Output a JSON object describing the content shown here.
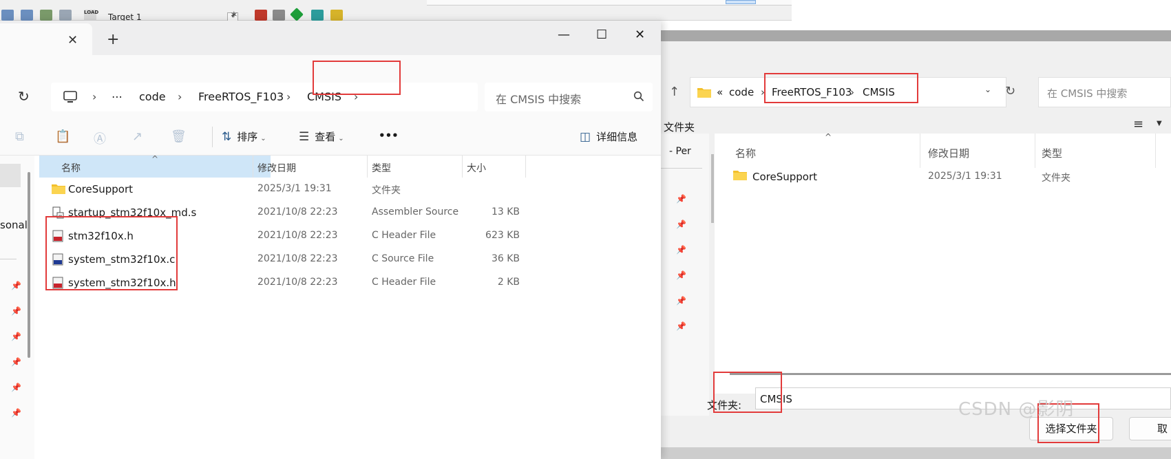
{
  "keil": {
    "target_label": "Target 1",
    "load_label": "LOAD"
  },
  "explorer": {
    "tab_close": "✕",
    "new_tab": "+",
    "window_buttons": {
      "minimize": "—",
      "maximize": "☐",
      "close": "✕"
    },
    "breadcrumb": [
      "code",
      "FreeRTOS_F103",
      "CMSIS"
    ],
    "breadcrumb_more": "⋯",
    "search_placeholder": "在 CMSIS 中搜索",
    "commands": {
      "sort": "排序",
      "view": "查看",
      "more": "•••",
      "details": "详细信息"
    },
    "nav_label": "sonal",
    "columns": {
      "name": "名称",
      "modified": "修改日期",
      "type": "类型",
      "size": "大小"
    },
    "files": [
      {
        "name": "CoreSupport",
        "modified": "2025/3/1 19:31",
        "type": "文件夹",
        "size": "",
        "icon": "folder-icon"
      },
      {
        "name": "startup_stm32f10x_md.s",
        "modified": "2021/10/8 22:23",
        "type": "Assembler Source",
        "size": "13 KB",
        "icon": "assembler-file-icon"
      },
      {
        "name": "stm32f10x.h",
        "modified": "2021/10/8 22:23",
        "type": "C Header File",
        "size": "623 KB",
        "icon": "c-header-file-icon"
      },
      {
        "name": "system_stm32f10x.c",
        "modified": "2021/10/8 22:23",
        "type": "C Source File",
        "size": "36 KB",
        "icon": "c-source-file-icon"
      },
      {
        "name": "system_stm32f10x.h",
        "modified": "2021/10/8 22:23",
        "type": "C Header File",
        "size": "2 KB",
        "icon": "c-header-file-icon"
      }
    ]
  },
  "dialog": {
    "path_prefix": "«",
    "breadcrumb": [
      "code",
      "FreeRTOS_F103",
      "CMSIS"
    ],
    "search_placeholder": "在 CMSIS 中搜索",
    "new_folder": "文件夹",
    "nav_label": "- Per",
    "columns": {
      "name": "名称",
      "modified": "修改日期",
      "type": "类型"
    },
    "row": {
      "name": "CoreSupport",
      "modified": "2025/3/1 19:31",
      "type": "文件夹"
    },
    "folder_label": "文件夹:",
    "folder_value": "CMSIS",
    "select_button": "选择文件夹",
    "cancel_button": "取消"
  },
  "watermark": "CSDN @影阴",
  "colors": {
    "annotation": "#e23a3a",
    "header_selected": "#cfe6f8",
    "folder": "#f3c02c"
  }
}
